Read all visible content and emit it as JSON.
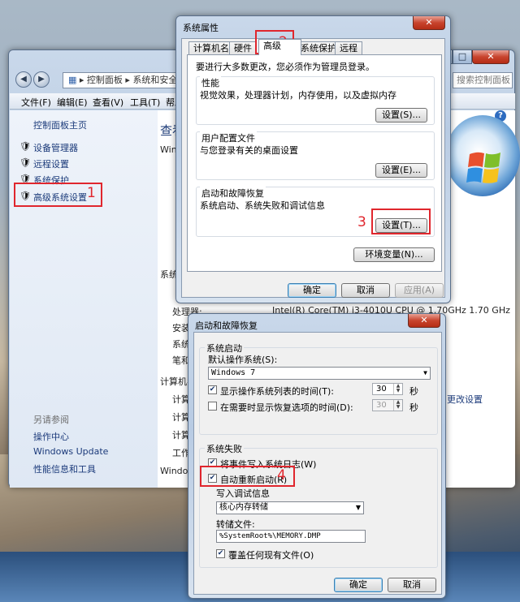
{
  "control_panel": {
    "address": [
      "控制面板",
      "系统和安全"
    ],
    "search_placeholder": "搜索控制面板",
    "menu": [
      "文件(F)",
      "编辑(E)",
      "查看(V)",
      "工具(T)",
      "帮助(H)"
    ],
    "left_home": "控制面板主页",
    "left_items": [
      "设备管理器",
      "远程设置",
      "系统保护",
      "高级系统设置"
    ],
    "see_also_title": "另请参阅",
    "see_also": [
      "操作中心",
      "Windows Update",
      "性能信息和工具"
    ],
    "right_heading": "查看",
    "right_fragments": [
      "Wind",
      "系统",
      "处理器:",
      "安装",
      "系统",
      "笔和",
      "计算机名",
      "计算",
      "计算",
      "计算",
      "工作",
      "Window"
    ],
    "processor_value": "Intel(R) Core(TM) i3-4010U CPU @ 1.70GHz   1.70 GHz",
    "change_settings_link": "更改设置"
  },
  "system_properties": {
    "title": "系统属性",
    "tabs": [
      "计算机名",
      "硬件",
      "高级",
      "系统保护",
      "远程"
    ],
    "admin_note": "要进行大多数更改，您必须作为管理员登录。",
    "performance": {
      "label": "性能",
      "desc": "视觉效果，处理器计划，内存使用，以及虚拟内存",
      "button": "设置(S)..."
    },
    "user_profiles": {
      "label": "用户配置文件",
      "desc": "与您登录有关的桌面设置",
      "button": "设置(E)..."
    },
    "startup_recovery": {
      "label": "启动和故障恢复",
      "desc": "系统启动、系统失败和调试信息",
      "button": "设置(T)..."
    },
    "env_button": "环境变量(N)...",
    "ok": "确定",
    "cancel": "取消",
    "apply": "应用(A)"
  },
  "startup_dialog": {
    "title": "启动和故障恢复",
    "system_startup_label": "系统启动",
    "default_os_label": "默认操作系统(S):",
    "default_os_value": "Windows 7",
    "show_os_list_label": "显示操作系统列表的时间(T):",
    "show_os_list_value": "30",
    "show_recovery_label": "在需要时显示恢复选项的时间(D):",
    "show_recovery_value": "30",
    "seconds": "秒",
    "system_failure_label": "系统失败",
    "write_event_label": "将事件写入系统日志(W)",
    "auto_restart_label": "自动重新启动(R)",
    "debug_info_label": "写入调试信息",
    "debug_info_value": "核心内存转储",
    "dump_file_label": "转储文件:",
    "dump_file_value": "%SystemRoot%\\MEMORY.DMP",
    "overwrite_label": "覆盖任何现有文件(O)",
    "ok": "确定",
    "cancel": "取消"
  },
  "annotations": [
    "1",
    "2",
    "3",
    "4"
  ]
}
